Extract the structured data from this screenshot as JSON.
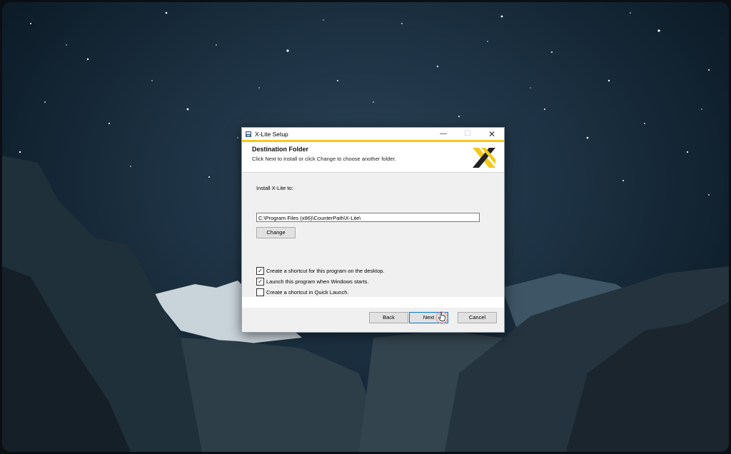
{
  "dialog": {
    "title": "X-Lite Setup",
    "minimize_glyph": "—",
    "maximize_glyph": "☐",
    "close_glyph": "✕",
    "header_title": "Destination Folder",
    "header_subtitle": "Click Next to install or click Change to choose another folder.",
    "install_label": "Install X-Lite to:",
    "install_path": "C:\\Program Files (x86)\\CounterPath\\X-Lite\\",
    "change_label": "Change",
    "checkboxes": [
      {
        "label": "Create a shortcut for this program on the desktop.",
        "checked": true,
        "glyph": "✓"
      },
      {
        "label": "Launch this program when Windows starts.",
        "checked": true,
        "glyph": "✓"
      },
      {
        "label": "Create a shortcut in Quick Launch.",
        "checked": false,
        "glyph": ""
      }
    ],
    "back_label": "Back",
    "next_label": "Next",
    "cancel_label": "Cancel"
  },
  "colors": {
    "accent_yellow": "#f3c81c",
    "focus_blue": "#0078d7",
    "logo_dark": "#222222"
  },
  "icons": [
    "setup-app-icon",
    "x-lite-logo",
    "hand-cursor-icon",
    "minimize-icon",
    "maximize-icon",
    "close-icon"
  ]
}
